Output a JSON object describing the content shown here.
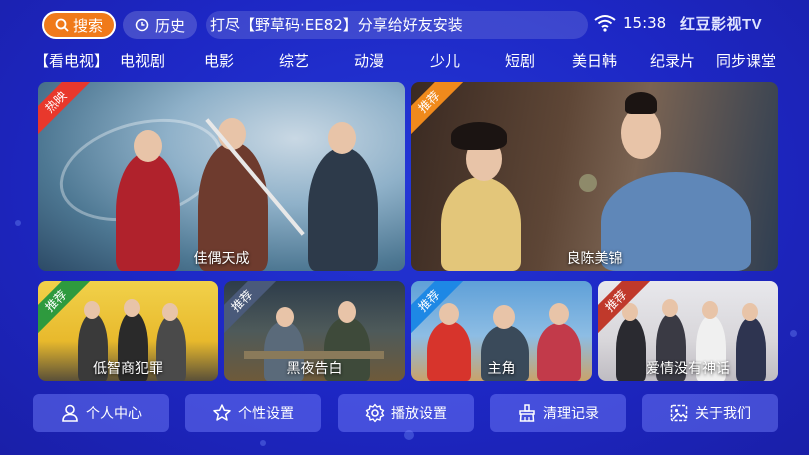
{
  "header": {
    "search_label": "搜索",
    "history_label": "历史",
    "marquee_text": "打尽【野草码·EE82】分享给好友安装",
    "time": "15:38",
    "logo_text": "红豆影视TV"
  },
  "nav": {
    "items": [
      "【看电视】",
      "电视剧",
      "电影",
      "综艺",
      "动漫",
      "少儿",
      "短剧",
      "美日韩",
      "纪录片",
      "同步课堂"
    ]
  },
  "featured": [
    {
      "title": "佳偶天成",
      "badge": "热映",
      "badge_color": "#e8382c"
    },
    {
      "title": "良陈美锦",
      "badge": "推荐",
      "badge_color": "#f08a1c"
    }
  ],
  "recommended": [
    {
      "title": "低智商犯罪",
      "badge": "推荐",
      "badge_color": "#2e9a3e"
    },
    {
      "title": "黑夜告白",
      "badge": "推荐",
      "badge_color": "#4a5a7a"
    },
    {
      "title": "主角",
      "badge": "推荐",
      "badge_color": "#1e88e5"
    },
    {
      "title": "爱情没有神话",
      "badge": "推荐",
      "badge_color": "#c0392b"
    }
  ],
  "bottom_menu": [
    {
      "label": "个人中心",
      "icon": "person-icon"
    },
    {
      "label": "个性设置",
      "icon": "star-icon"
    },
    {
      "label": "播放设置",
      "icon": "gear-icon"
    },
    {
      "label": "清理记录",
      "icon": "broom-icon"
    },
    {
      "label": "关于我们",
      "icon": "image-icon"
    }
  ],
  "colors": {
    "background": "#1d27c4",
    "search_button": "#f07a1a"
  }
}
